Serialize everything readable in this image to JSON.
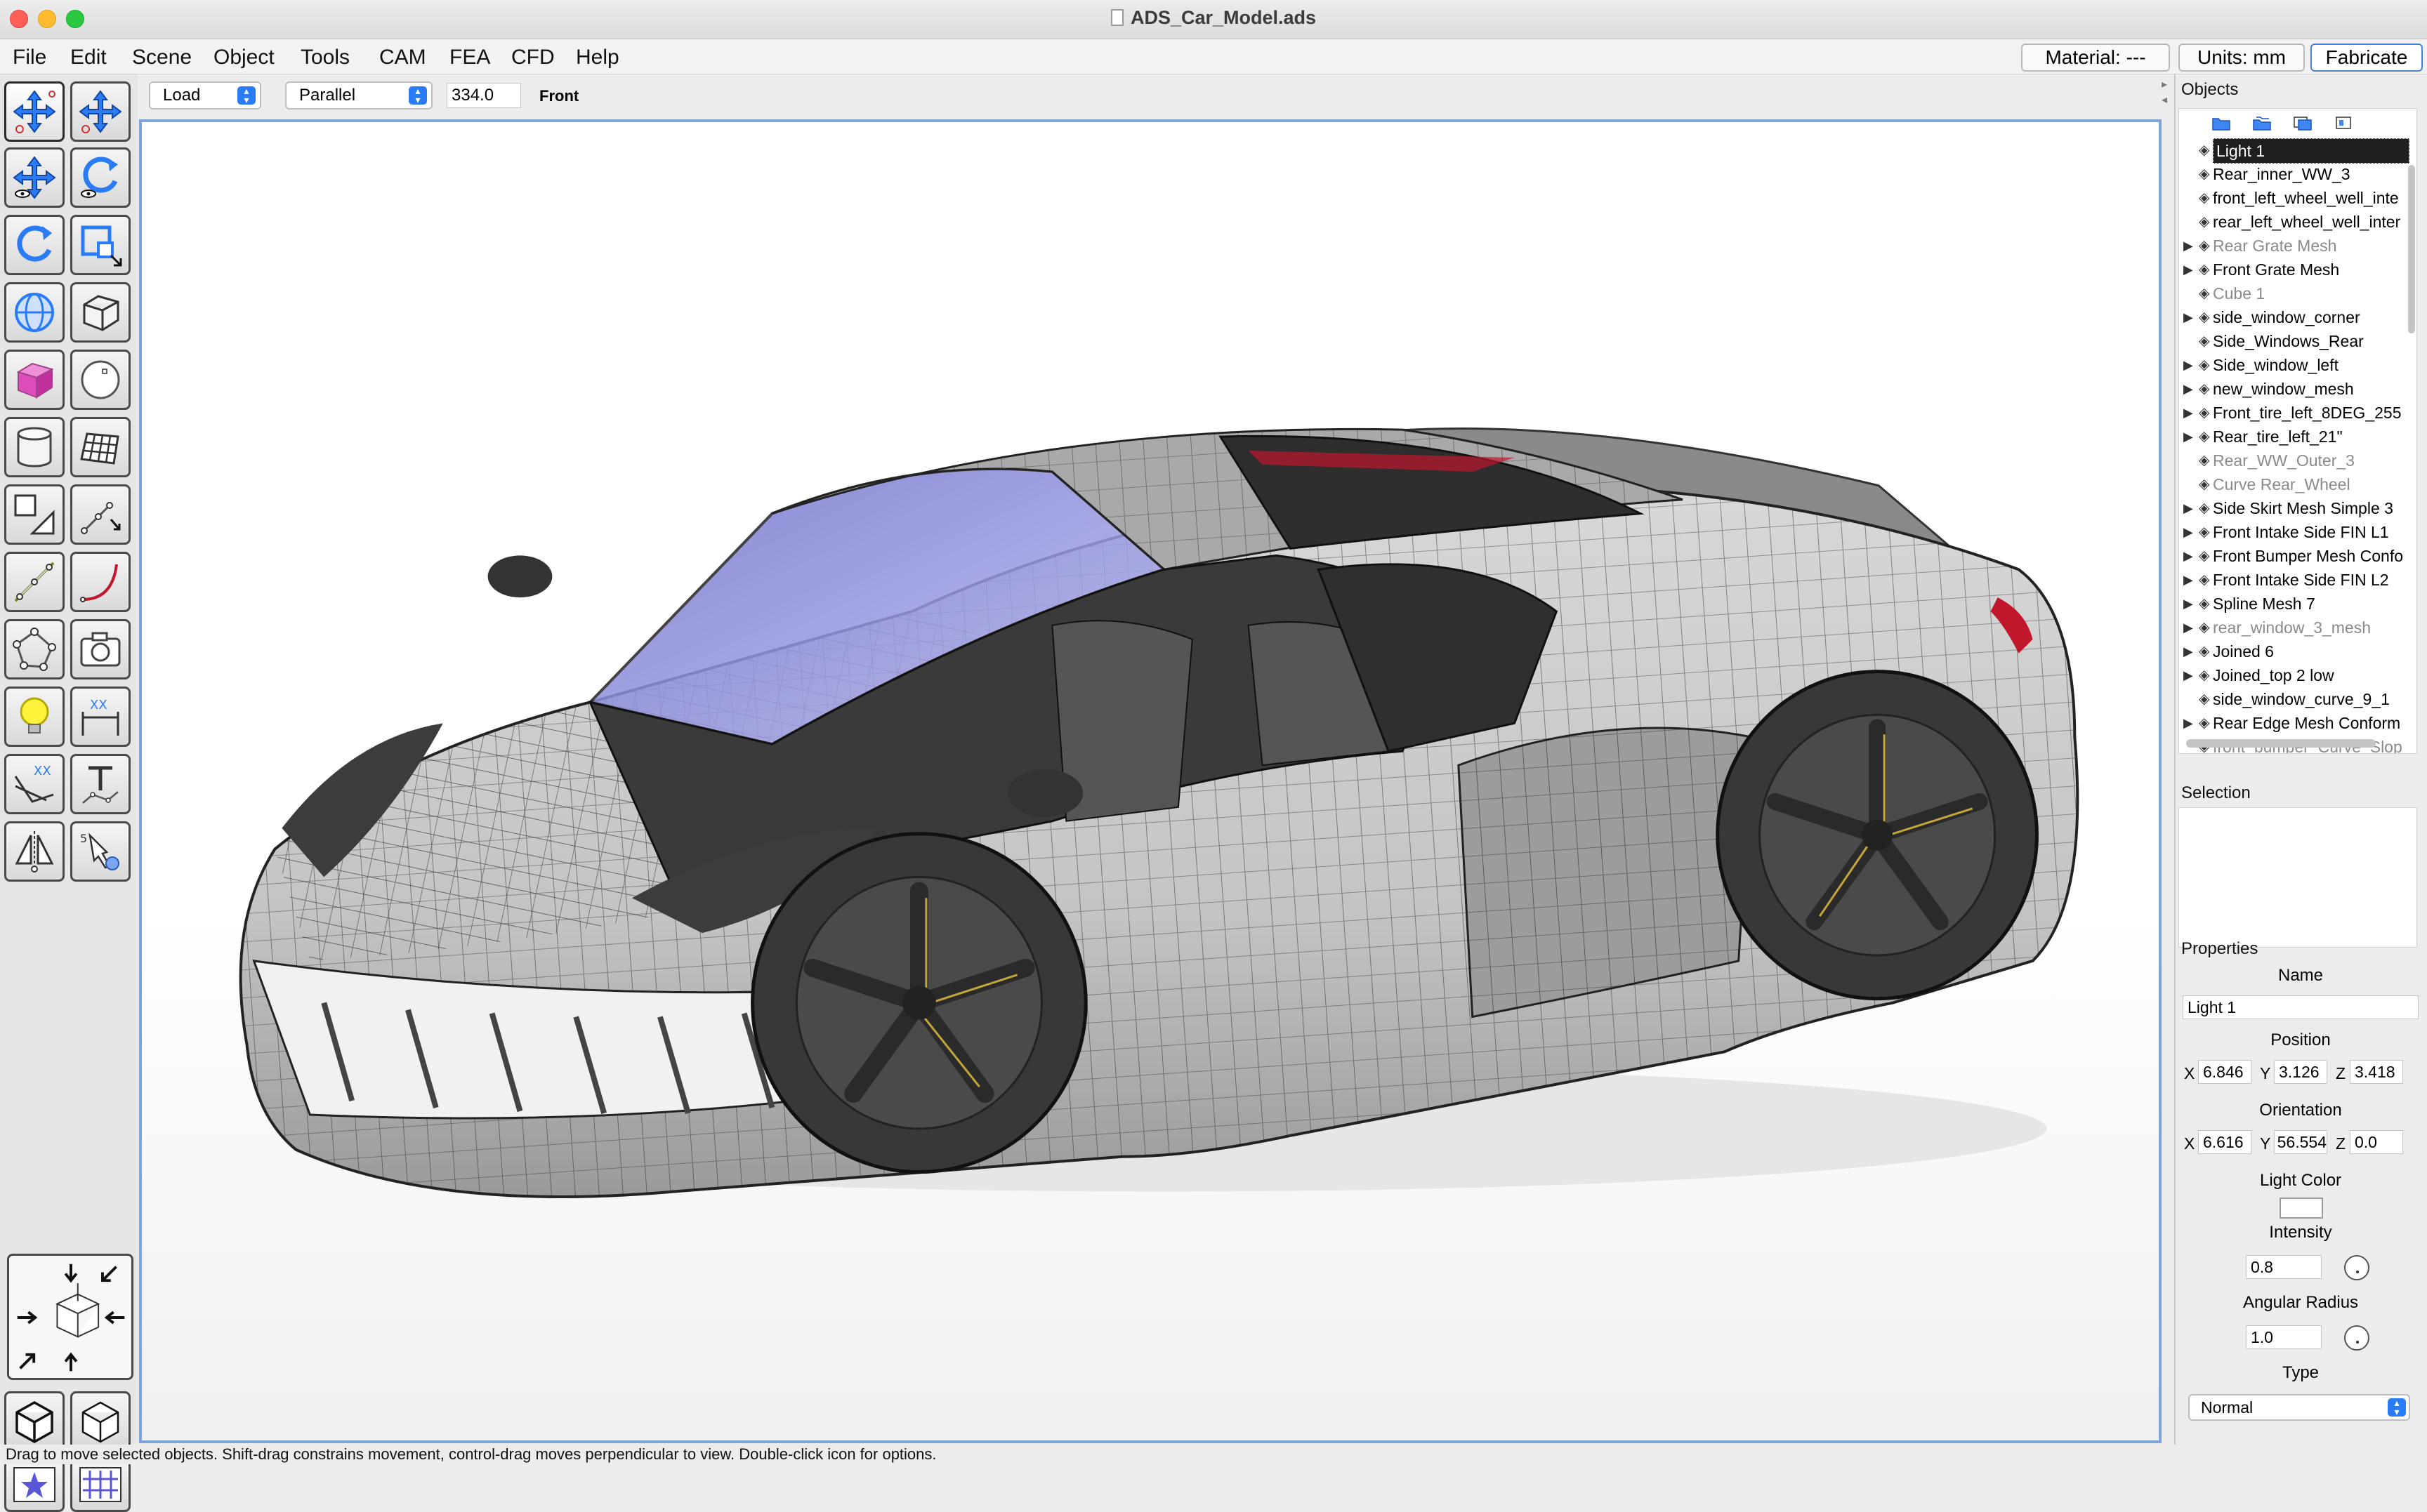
{
  "window": {
    "title": "ADS_Car_Model.ads"
  },
  "menubar": {
    "items": [
      "File",
      "Edit",
      "Scene",
      "Object",
      "Tools",
      "CAM",
      "FEA",
      "CFD",
      "Help"
    ],
    "material": "Material: ---",
    "units": "Units: mm",
    "fabricate": "Fabricate"
  },
  "viewbar": {
    "mode": "Load",
    "projection": "Parallel",
    "scale": "334.0",
    "view": "Front"
  },
  "tools": [
    {
      "name": "move-selected-tool",
      "active": true
    },
    {
      "name": "move-points-tool",
      "active": false
    },
    {
      "name": "move-view-tool",
      "active": false
    },
    {
      "name": "rotate-view-tool",
      "active": false
    },
    {
      "name": "rotate-object-tool",
      "active": false
    },
    {
      "name": "scale-object-tool",
      "active": false
    },
    {
      "name": "sphere-tool",
      "active": false
    },
    {
      "name": "cube-outline-tool",
      "active": false
    },
    {
      "name": "cube-tool",
      "active": false
    },
    {
      "name": "circle-tool",
      "active": false
    },
    {
      "name": "cylinder-tool",
      "active": false
    },
    {
      "name": "grid-mesh-tool",
      "active": false
    },
    {
      "name": "polygon-tool",
      "active": false
    },
    {
      "name": "line-tool",
      "active": false
    },
    {
      "name": "spline-tool",
      "active": false
    },
    {
      "name": "curve-tool",
      "active": false
    },
    {
      "name": "points-tool",
      "active": false
    },
    {
      "name": "camera-tool",
      "active": false
    },
    {
      "name": "light-tool",
      "active": false
    },
    {
      "name": "dimension-tool",
      "active": false
    },
    {
      "name": "angle-dimension-tool",
      "active": false
    },
    {
      "name": "text-tool",
      "active": false
    },
    {
      "name": "mirror-tool",
      "active": false
    },
    {
      "name": "script-tool",
      "active": false
    }
  ],
  "objects": {
    "title": "Objects",
    "items": [
      {
        "label": "Light 1",
        "expand": false,
        "selected": true,
        "dim": false
      },
      {
        "label": "Rear_inner_WW_3",
        "expand": false,
        "selected": false,
        "dim": false
      },
      {
        "label": "front_left_wheel_well_inte",
        "expand": false,
        "selected": false,
        "dim": false
      },
      {
        "label": "rear_left_wheel_well_inter",
        "expand": false,
        "selected": false,
        "dim": false
      },
      {
        "label": "Rear Grate Mesh",
        "expand": true,
        "selected": false,
        "dim": true
      },
      {
        "label": "Front Grate Mesh",
        "expand": true,
        "selected": false,
        "dim": false
      },
      {
        "label": "Cube 1",
        "expand": false,
        "selected": false,
        "dim": true
      },
      {
        "label": "side_window_corner",
        "expand": true,
        "selected": false,
        "dim": false
      },
      {
        "label": "Side_Windows_Rear",
        "expand": false,
        "selected": false,
        "dim": false
      },
      {
        "label": "Side_window_left",
        "expand": true,
        "selected": false,
        "dim": false
      },
      {
        "label": "new_window_mesh",
        "expand": true,
        "selected": false,
        "dim": false
      },
      {
        "label": "Front_tire_left_8DEG_255",
        "expand": true,
        "selected": false,
        "dim": false
      },
      {
        "label": "Rear_tire_left_21\"",
        "expand": true,
        "selected": false,
        "dim": false
      },
      {
        "label": "Rear_WW_Outer_3",
        "expand": false,
        "selected": false,
        "dim": true
      },
      {
        "label": "Curve Rear_Wheel",
        "expand": false,
        "selected": false,
        "dim": true
      },
      {
        "label": "Side Skirt Mesh Simple 3",
        "expand": true,
        "selected": false,
        "dim": false
      },
      {
        "label": "Front Intake Side FIN L1",
        "expand": true,
        "selected": false,
        "dim": false
      },
      {
        "label": "Front Bumper Mesh Confo",
        "expand": true,
        "selected": false,
        "dim": false
      },
      {
        "label": "Front Intake Side FIN L2",
        "expand": true,
        "selected": false,
        "dim": false
      },
      {
        "label": "Spline Mesh 7",
        "expand": true,
        "selected": false,
        "dim": false
      },
      {
        "label": "rear_window_3_mesh",
        "expand": true,
        "selected": false,
        "dim": true
      },
      {
        "label": "Joined 6",
        "expand": true,
        "selected": false,
        "dim": false
      },
      {
        "label": "Joined_top 2 low",
        "expand": true,
        "selected": false,
        "dim": false
      },
      {
        "label": "side_window_curve_9_1",
        "expand": false,
        "selected": false,
        "dim": false
      },
      {
        "label": "Rear Edge Mesh Conform",
        "expand": true,
        "selected": false,
        "dim": false
      },
      {
        "label": "front_bumper_Curve_Slop",
        "expand": false,
        "selected": false,
        "dim": true
      }
    ]
  },
  "selection": {
    "title": "Selection"
  },
  "properties": {
    "title": "Properties",
    "name_label": "Name",
    "name_value": "Light 1",
    "position_label": "Position",
    "position": {
      "x": "6.846",
      "y": "3.126",
      "z": "3.418"
    },
    "orientation_label": "Orientation",
    "orientation": {
      "x": "6.616",
      "y": "56.554",
      "z": "0.0"
    },
    "light_color_label": "Light Color",
    "intensity_label": "Intensity",
    "intensity": "0.8",
    "angular_radius_label": "Angular Radius",
    "angular_radius": "1.0",
    "type_label": "Type",
    "type_value": "Normal",
    "axis_x": "X",
    "axis_y": "Y",
    "axis_z": "Z"
  },
  "status": {
    "text": "Drag to move selected objects.  Shift-drag constrains movement, control-drag moves perpendicular to view.  Double-click icon for options."
  },
  "colors": {
    "accent": "#2a7bf6",
    "viewport_border": "#7ea3d9",
    "car_body": "#c9c9c9",
    "window_tint": "#8f90e8"
  }
}
